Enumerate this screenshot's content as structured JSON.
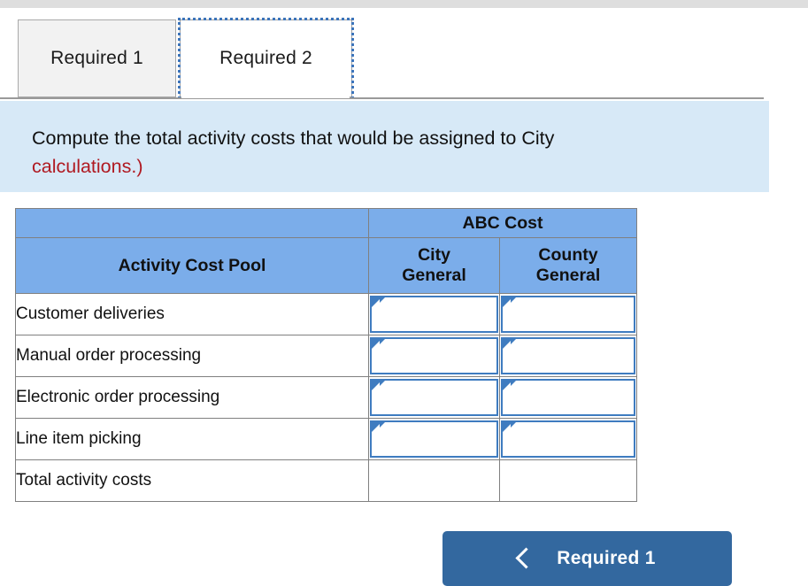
{
  "window": {
    "top_strip_color": "#dedede"
  },
  "tabs": {
    "items": [
      {
        "label": "Required 1",
        "active": false
      },
      {
        "label": "Required 2",
        "active": true
      }
    ]
  },
  "instruction": {
    "line1": "Compute the total activity costs that would be assigned to City",
    "line2": "calculations.)",
    "note_color": "#b01a22",
    "panel_color": "#d7e9f7"
  },
  "table": {
    "group_header": "ABC Cost",
    "columns": {
      "label": "Activity Cost Pool",
      "city": "City\nGeneral",
      "city_line1": "City",
      "city_line2": "General",
      "county_line1": "County",
      "county_line2": "General"
    },
    "header_color": "#7badea",
    "input_border_color": "#3f7cc0",
    "rows": [
      {
        "label": "Customer deliveries",
        "city": "",
        "county": "",
        "type": "input"
      },
      {
        "label": "Manual order processing",
        "city": "",
        "county": "",
        "type": "input"
      },
      {
        "label": "Electronic order processing",
        "city": "",
        "county": "",
        "type": "input"
      },
      {
        "label": "Line item picking",
        "city": "",
        "county": "",
        "type": "input"
      },
      {
        "label": "Total activity costs",
        "city": "",
        "county": "",
        "type": "total"
      }
    ]
  },
  "footer": {
    "prev_button_label": "Required 1",
    "prev_button_icon": "chevron-left-icon",
    "prev_button_color": "#33689f"
  }
}
